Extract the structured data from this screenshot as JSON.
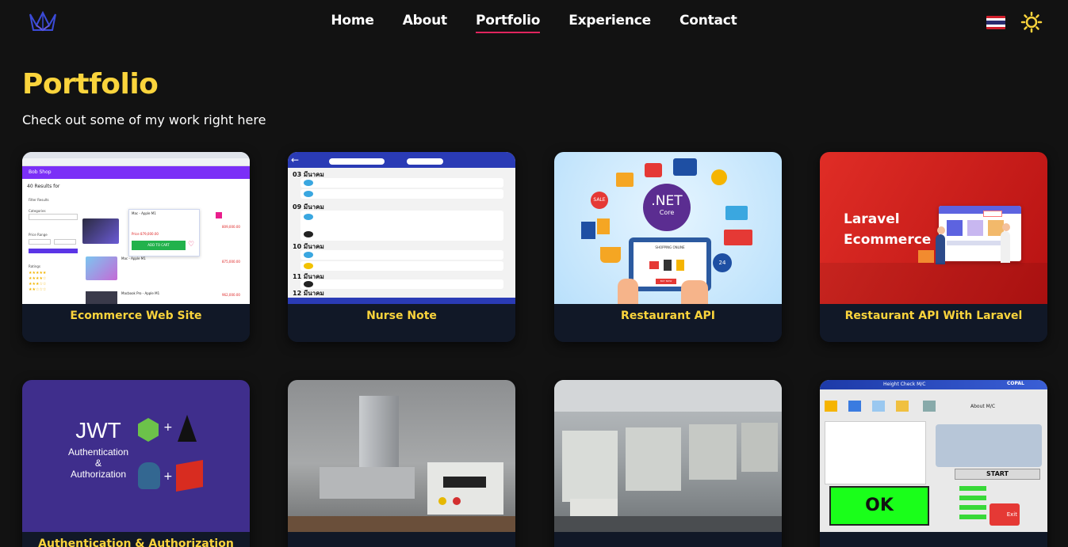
{
  "nav": {
    "links": [
      {
        "label": "Home"
      },
      {
        "label": "About"
      },
      {
        "label": "Portfolio"
      },
      {
        "label": "Experience"
      },
      {
        "label": "Contact"
      }
    ],
    "active": "Portfolio"
  },
  "header": {
    "title": "Portfolio",
    "subtitle": "Check out some of my work right here"
  },
  "projects": [
    {
      "title": "Ecommerce Web Site"
    },
    {
      "title": "Nurse Note"
    },
    {
      "title": "Restaurant API"
    },
    {
      "title": "Restaurant API With Laravel"
    },
    {
      "title": "Authentication & Authorization"
    },
    {
      "title": ""
    },
    {
      "title": ""
    },
    {
      "title": ""
    }
  ],
  "thumbs": {
    "ecommerce": {
      "shop": "Bob Shop",
      "results": "40 Results for",
      "filter": "Filter Results",
      "categories": "Categories",
      "price": "Price Range",
      "ratings": "Ratings",
      "product1": "Mac - Apple M1",
      "product2": "Macbook Pro - Apple M1",
      "price1": "Price 879,000.00",
      "add": "ADD TO CART",
      "p1": "809,000.00",
      "p2": "875,000.00",
      "p3": "962,000.00"
    },
    "nurse": {
      "rows": [
        "03 มีนาคม",
        "09 มีนาคม",
        "10 มีนาคม",
        "11 มีนาคม",
        "12 มีนาคม"
      ]
    },
    "net": {
      "logo": ".NET",
      "sub": "Core",
      "shop": "SHOPPING ONLINE",
      "buy": "BUY NOW",
      "sale": "SALE",
      "n24": "24"
    },
    "laravel": {
      "line1": "Laravel",
      "line2": "Ecommerce"
    },
    "jwt": {
      "title": "JWT",
      "line1": "Authentication",
      "line2": "&",
      "line3": "Authorization",
      "plus": "+"
    },
    "height": {
      "title": "Height Check M/C",
      "about": "About M/C",
      "start": "START",
      "ok": "OK",
      "exit": "Exit",
      "brand": "COPAL"
    }
  },
  "colors": {
    "background": "#121212",
    "accent": "#fad43c",
    "card": "#111827",
    "active_underline": "#e0245e"
  }
}
